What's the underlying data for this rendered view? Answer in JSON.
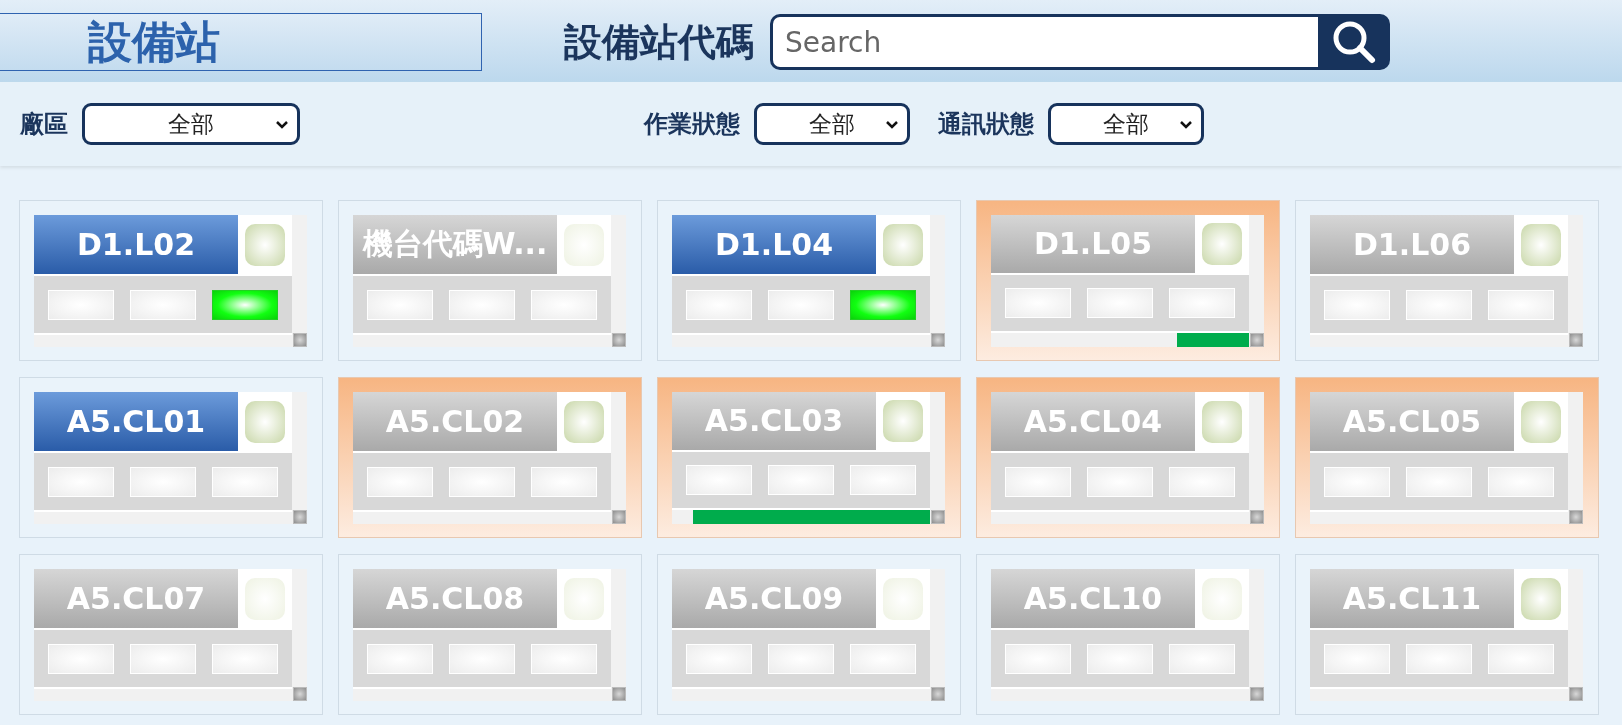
{
  "header": {
    "title": "設備站",
    "search_label": "設備站代碼",
    "search": {
      "placeholder": "Search"
    }
  },
  "filters": [
    {
      "label": "廠區",
      "value": "全部"
    },
    {
      "label": "作業狀態",
      "value": "全部"
    },
    {
      "label": "通訊狀態",
      "value": "全部"
    }
  ],
  "stations": [
    {
      "name": "D1.L02",
      "highlighted": true,
      "alert": false,
      "lamp_on": true,
      "indicators": [
        {
          "on": false
        },
        {
          "on": false
        },
        {
          "on": true
        }
      ]
    },
    {
      "name": "機台代碼W...",
      "highlighted": false,
      "alert": false,
      "lamp_on": false,
      "indicators": [
        {
          "on": false
        },
        {
          "on": false
        },
        {
          "on": false
        }
      ]
    },
    {
      "name": "D1.L04",
      "highlighted": true,
      "alert": false,
      "lamp_on": true,
      "indicators": [
        {
          "on": false
        },
        {
          "on": false
        },
        {
          "on": true
        }
      ]
    },
    {
      "name": "D1.L05",
      "highlighted": false,
      "alert": true,
      "lamp_on": true,
      "indicators": [
        {
          "on": false
        },
        {
          "on": false
        },
        {
          "on": false
        }
      ],
      "level": 0.28
    },
    {
      "name": "D1.L06",
      "highlighted": false,
      "alert": false,
      "lamp_on": true,
      "indicators": [
        {
          "on": false
        },
        {
          "on": false
        },
        {
          "on": false
        }
      ]
    },
    {
      "name": "A5.CL01",
      "highlighted": true,
      "alert": false,
      "lamp_on": true,
      "indicators": [
        {
          "on": false
        },
        {
          "on": false
        },
        {
          "on": false
        }
      ]
    },
    {
      "name": "A5.CL02",
      "highlighted": false,
      "alert": true,
      "lamp_on": true,
      "indicators": [
        {
          "on": false
        },
        {
          "on": false
        },
        {
          "on": false
        }
      ]
    },
    {
      "name": "A5.CL03",
      "highlighted": false,
      "alert": true,
      "lamp_on": true,
      "indicators": [
        {
          "on": false
        },
        {
          "on": false
        },
        {
          "on": false
        }
      ],
      "level": 0.92
    },
    {
      "name": "A5.CL04",
      "highlighted": false,
      "alert": true,
      "lamp_on": true,
      "indicators": [
        {
          "on": false
        },
        {
          "on": false
        },
        {
          "on": false
        }
      ]
    },
    {
      "name": "A5.CL05",
      "highlighted": false,
      "alert": true,
      "lamp_on": true,
      "indicators": [
        {
          "on": false
        },
        {
          "on": false
        },
        {
          "on": false
        }
      ]
    },
    {
      "name": "A5.CL07",
      "highlighted": false,
      "alert": false,
      "lamp_on": false,
      "indicators": [
        {
          "on": false
        },
        {
          "on": false
        },
        {
          "on": false
        }
      ]
    },
    {
      "name": "A5.CL08",
      "highlighted": false,
      "alert": false,
      "lamp_on": false,
      "indicators": [
        {
          "on": false
        },
        {
          "on": false
        },
        {
          "on": false
        }
      ]
    },
    {
      "name": "A5.CL09",
      "highlighted": false,
      "alert": false,
      "lamp_on": false,
      "indicators": [
        {
          "on": false
        },
        {
          "on": false
        },
        {
          "on": false
        }
      ]
    },
    {
      "name": "A5.CL10",
      "highlighted": false,
      "alert": false,
      "lamp_on": false,
      "indicators": [
        {
          "on": false
        },
        {
          "on": false
        },
        {
          "on": false
        }
      ]
    },
    {
      "name": "A5.CL11",
      "highlighted": false,
      "alert": false,
      "lamp_on": true,
      "indicators": [
        {
          "on": false
        },
        {
          "on": false
        },
        {
          "on": false
        }
      ]
    }
  ]
}
